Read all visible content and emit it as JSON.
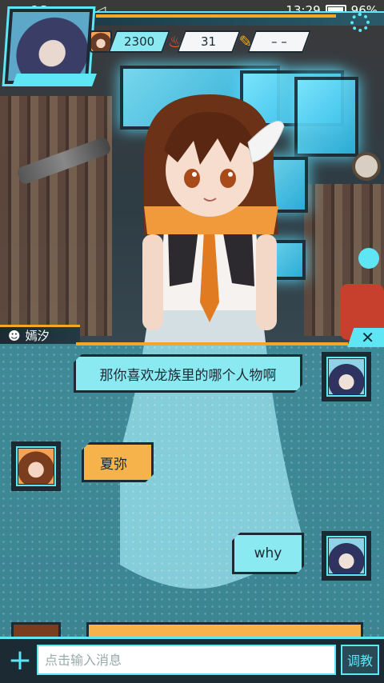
{
  "status_bar": {
    "signal": "2G",
    "time": "13:29",
    "battery": "96%"
  },
  "hud": {
    "stat_1": "2300",
    "stat_2": "31",
    "stat_3": "– –",
    "stat_icons": [
      "avatar-mini",
      "flame-icon",
      "feather-icon"
    ],
    "accent": "#5ee6f5",
    "orange": "#f5a623"
  },
  "dialogue": {
    "speaker_name": "嫣汐",
    "close_label": "✕",
    "messages": [
      {
        "side": "right",
        "sender": "player",
        "text": "那你喜欢龙族里的哪个人物啊"
      },
      {
        "side": "left",
        "sender": "character",
        "text": "夏弥"
      },
      {
        "side": "right",
        "sender": "player",
        "text": "why"
      }
    ]
  },
  "input": {
    "placeholder": "点击输入消息",
    "value": "",
    "send_label": "调教",
    "plus_label": "+"
  }
}
